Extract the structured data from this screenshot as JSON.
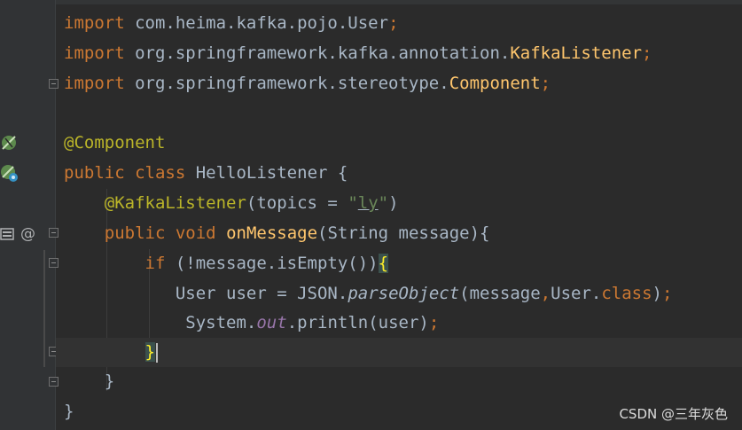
{
  "colors": {
    "background": "#2b2b2b",
    "gutter": "#313335",
    "keyword": "#cc7832",
    "annotation": "#bbb529",
    "method": "#ffc66d",
    "string": "#6a8759",
    "default": "#a9b7c6",
    "field": "#9876aa"
  },
  "code": {
    "l1": {
      "kw": "import",
      "pkg": " com.heima.kafka.pojo.User",
      "semi": ";"
    },
    "l2": {
      "kw": "import",
      "pkg": " org.springframework.kafka.annotation.",
      "cls": "KafkaListener",
      "semi": ";"
    },
    "l3": {
      "kw": "import",
      "pkg": " org.springframework.stereotype.",
      "cls": "Component",
      "semi": ";"
    },
    "l5": {
      "ann": "@Component"
    },
    "l6": {
      "kw1": "public",
      "kw2": "class",
      "name": " HelloListener {"
    },
    "l7": {
      "ann": "@KafkaListener",
      "a": "(topics = ",
      "q1": "\"",
      "str": "ly",
      "q2": "\"",
      "b": ")"
    },
    "l8": {
      "kw1": "public",
      "kw2": "void",
      "method": "onMessage",
      "params": "(String message){"
    },
    "l9": {
      "kw": "if",
      "cond": " (!message.isEmpty())",
      "brace": "{"
    },
    "l10": {
      "a": "User user = JSON.",
      "method": "parseObject",
      "b": "(message",
      "comma": ",",
      "c": "User.",
      "kw": "class",
      "d": ")",
      "semi": ";"
    },
    "l11": {
      "a": "System.",
      "field": "out",
      "b": ".println(user)",
      "semi": ";"
    },
    "l12": {
      "brace": "}"
    },
    "l13": {
      "brace": "}"
    },
    "l14": {
      "brace": "}"
    }
  },
  "watermark": "CSDN @三年灰色"
}
